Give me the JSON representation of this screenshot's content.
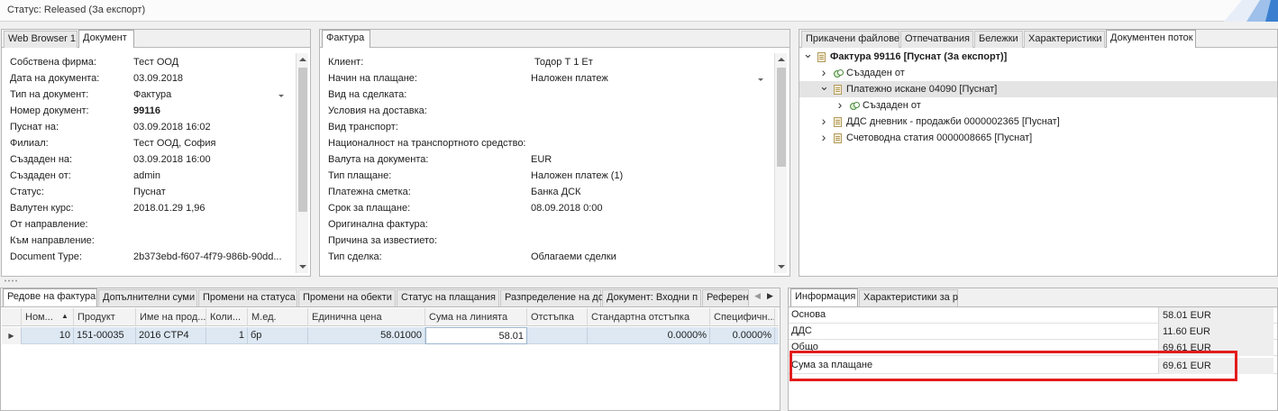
{
  "status": {
    "text": "Статус: Released (За експорт)"
  },
  "left_panel": {
    "tabs": [
      {
        "label": "Web Browser 1",
        "active": false
      },
      {
        "label": "Документ",
        "active": true
      }
    ],
    "fields": [
      {
        "label": "Собствена фирма:",
        "value": "Тест ООД"
      },
      {
        "label": "Дата на документа:",
        "value": "03.09.2018"
      },
      {
        "label": "Тип на документ:",
        "value": "Фактура"
      },
      {
        "label": "Номер документ:",
        "value": "99116"
      },
      {
        "label": "Пуснат на:",
        "value": "03.09.2018 16:02"
      },
      {
        "label": "Филиал:",
        "value": "Тест ООД, София"
      },
      {
        "label": "Създаден на:",
        "value": "03.09.2018 16:00"
      },
      {
        "label": "Създаден от:",
        "value": "admin"
      },
      {
        "label": "Статус:",
        "value": "Пуснат"
      },
      {
        "label": "Валутен курс:",
        "value": "2018.01.29 1,96"
      },
      {
        "label": "От направление:",
        "value": ""
      },
      {
        "label": "Към направление:",
        "value": ""
      },
      {
        "label": "Document Type:",
        "value": "2b373ebd-f607-4f79-986b-90dd..."
      }
    ]
  },
  "middle_panel": {
    "tabs": [
      {
        "label": "Фактура",
        "active": true
      }
    ],
    "fields": [
      {
        "label": "Клиент:",
        "value": "Тодор Т 1 Ет"
      },
      {
        "label": "Начин на плащане:",
        "value": "Наложен платеж"
      },
      {
        "label": "Вид на сделката:",
        "value": ""
      },
      {
        "label": "Условия на доставка:",
        "value": ""
      },
      {
        "label": "Вид транспорт:",
        "value": ""
      },
      {
        "label": "Националност на транспортното средство:",
        "value": ""
      },
      {
        "label": "Валута на документа:",
        "value": "EUR"
      },
      {
        "label": "Тип плащане:",
        "value": "Наложен платеж (1)"
      },
      {
        "label": "Платежна сметка:",
        "value": "Банка ДСК"
      },
      {
        "label": "Срок за плащане:",
        "value": "08.09.2018 0:00"
      },
      {
        "label": "Оригинална фактура:",
        "value": ""
      },
      {
        "label": "Причина за известието:",
        "value": ""
      },
      {
        "label": "Тип сделка:",
        "value": "Облагаеми сделки"
      }
    ]
  },
  "right_panel": {
    "tabs": [
      {
        "label": "Прикачени файлове",
        "active": false
      },
      {
        "label": "Отпечатвания",
        "active": false
      },
      {
        "label": "Бележки",
        "active": false
      },
      {
        "label": "Характеристики",
        "active": false
      },
      {
        "label": "Документен поток",
        "active": true
      }
    ],
    "tree": [
      {
        "label": "Фактура 99116 [Пуснат (За експорт)]",
        "level": 0,
        "expanded": true,
        "bold": true,
        "icon": "document-icon"
      },
      {
        "label": "Създаден от",
        "level": 1,
        "expanded": false,
        "bold": false,
        "icon": "link-icon"
      },
      {
        "label": "Платежно искане 04090 [Пуснат]",
        "level": 1,
        "expanded": true,
        "bold": false,
        "icon": "document-icon"
      },
      {
        "label": "Създаден от",
        "level": 2,
        "expanded": false,
        "bold": false,
        "icon": "link-icon"
      },
      {
        "label": "ДДС дневник - продажби 0000002365 [Пуснат]",
        "level": 1,
        "expanded": false,
        "bold": false,
        "icon": "document-icon"
      },
      {
        "label": "Счетоводна статия 0000008665 [Пуснат]",
        "level": 1,
        "expanded": false,
        "bold": false,
        "icon": "document-icon"
      }
    ]
  },
  "bottom_left": {
    "tabs": [
      {
        "label": "Редове на фактура",
        "active": true
      },
      {
        "label": "Допълнителни суми",
        "active": false
      },
      {
        "label": "Промени на статуса",
        "active": false
      },
      {
        "label": "Промени на обекти",
        "active": false
      },
      {
        "label": "Статус на плащания",
        "active": false
      },
      {
        "label": "Разпределение на до",
        "active": false
      },
      {
        "label": "Документ: Входни п",
        "active": false
      },
      {
        "label": "Референ",
        "active": false
      }
    ],
    "columns": [
      "Ном...",
      "Продукт",
      "Име на прод...",
      "Коли...",
      "М.ед.",
      "Единична цена",
      "Сума на линията",
      "Отстъпка",
      "Стандартна отстъпка",
      "Специфичн..."
    ],
    "rows": [
      [
        "10",
        "151-00035",
        "2016 CTP4",
        "1",
        "бр",
        "58.01000",
        "58.01",
        "",
        "0.0000%",
        "0.0000%"
      ]
    ]
  },
  "bottom_right": {
    "tabs": [
      {
        "label": "Информация",
        "active": true
      },
      {
        "label": "Характеристики за р",
        "active": false
      }
    ],
    "rows": [
      {
        "label": "Основа",
        "value": "58.01 EUR"
      },
      {
        "label": "ДДС",
        "value": "11.60 EUR"
      },
      {
        "label": "Общо",
        "value": "69.61 EUR"
      },
      {
        "label": "Сума за плащане",
        "value": "69.61 EUR"
      }
    ]
  },
  "colors": {
    "highlight_box": "#e31c1c",
    "selected_row": "#dde8f3",
    "corner_accent": "#3a7fcf"
  }
}
